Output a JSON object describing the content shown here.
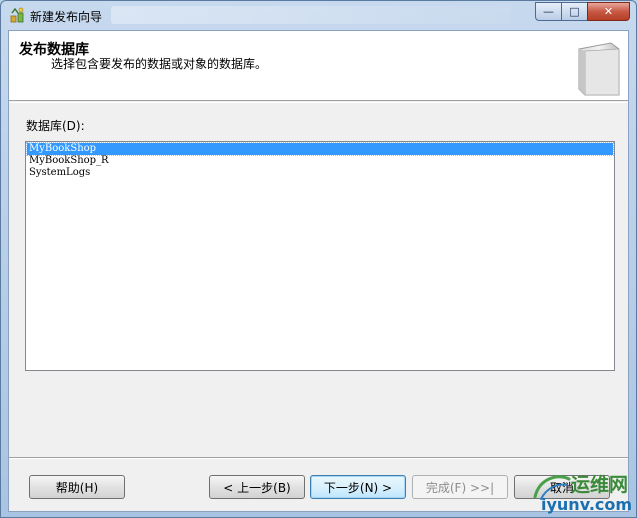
{
  "window": {
    "title": "新建发布向导",
    "controls": {
      "minimize": "—",
      "maximize": "□",
      "close": "✕"
    }
  },
  "header": {
    "title": "发布数据库",
    "subtitle": "选择包含要发布的数据或对象的数据库。"
  },
  "databases": {
    "label": "数据库(D):",
    "items": [
      "MyBookShop",
      "MyBookShop_R",
      "SystemLogs"
    ],
    "selected_index": 0
  },
  "buttons": {
    "help": "帮助(H)",
    "back": "< 上一步(B)",
    "next": "下一步(N) >",
    "finish": "完成(F) >>|",
    "cancel": "取消"
  },
  "watermark": {
    "top": "运维网",
    "bottom": "iyunv.com"
  },
  "colors": {
    "selection": "#3399ff",
    "close_button": "#c75a45",
    "client_bg": "#f0f0f0"
  }
}
